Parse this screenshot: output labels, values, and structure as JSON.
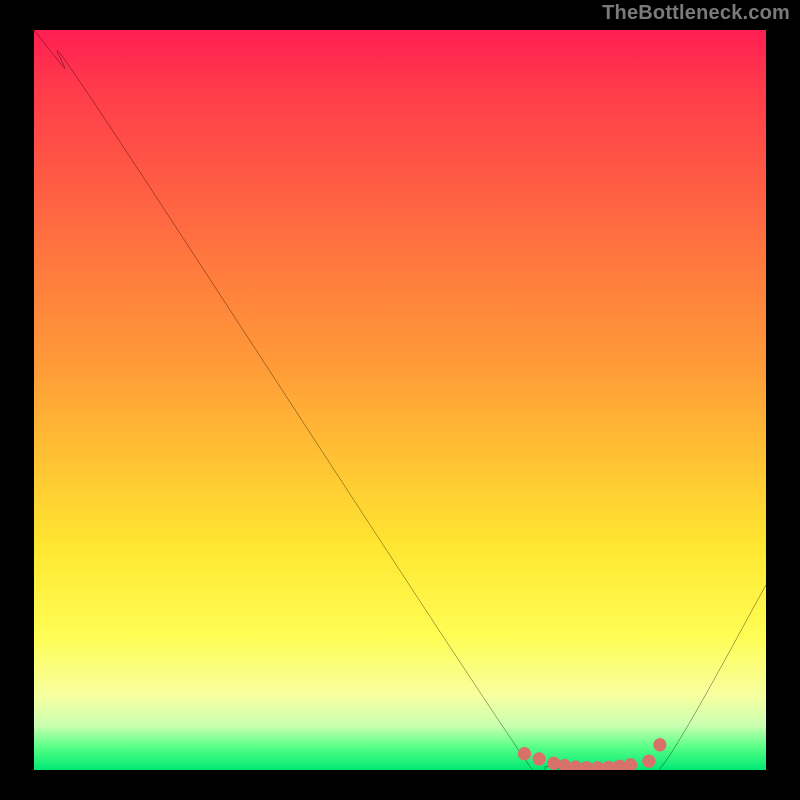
{
  "watermark": "TheBottleneck.com",
  "chart_data": {
    "type": "line",
    "title": "",
    "xlabel": "",
    "ylabel": "",
    "xlim": [
      0,
      100
    ],
    "ylim": [
      0,
      100
    ],
    "grid": false,
    "legend": false,
    "note": "Curve read as percentage of plot width (x) and height (y, 0=bottom, 100=top). Bottleneck-style V curve with marker cluster at the trough.",
    "series": [
      {
        "name": "curve",
        "x": [
          0,
          4,
          9,
          66,
          70,
          75,
          81,
          86,
          100
        ],
        "y": [
          100,
          95,
          89,
          3,
          0.5,
          0,
          0,
          0.8,
          25
        ]
      }
    ],
    "markers": {
      "name": "highlight-band",
      "color": "#d9716b",
      "x": [
        67,
        69,
        71,
        72.5,
        74,
        75.5,
        77,
        78.5,
        80,
        81.5,
        84,
        85.5
      ],
      "y": [
        2.2,
        1.5,
        0.9,
        0.6,
        0.4,
        0.3,
        0.3,
        0.35,
        0.5,
        0.7,
        1.2,
        3.4
      ]
    },
    "gradient_stops": [
      {
        "pos": 0,
        "color": "#ff1f52"
      },
      {
        "pos": 8,
        "color": "#ff3b4b"
      },
      {
        "pos": 20,
        "color": "#ff5a44"
      },
      {
        "pos": 32,
        "color": "#ff7a3e"
      },
      {
        "pos": 45,
        "color": "#ff9a38"
      },
      {
        "pos": 58,
        "color": "#ffc233"
      },
      {
        "pos": 70,
        "color": "#ffe731"
      },
      {
        "pos": 82,
        "color": "#fffd55"
      },
      {
        "pos": 90,
        "color": "#f7ffa0"
      },
      {
        "pos": 94,
        "color": "#caffb0"
      },
      {
        "pos": 97,
        "color": "#54ff86"
      },
      {
        "pos": 100,
        "color": "#00e874"
      }
    ]
  }
}
